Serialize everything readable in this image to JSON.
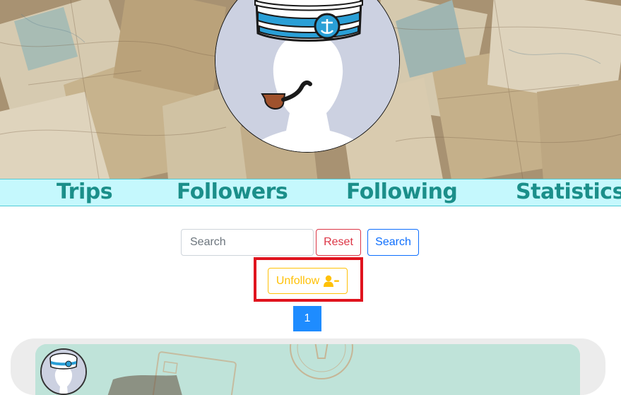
{
  "nav": {
    "trips": "Trips",
    "followers": "Followers",
    "following": "Following",
    "statistics": "Statistics"
  },
  "search": {
    "placeholder": "Search",
    "value": ""
  },
  "buttons": {
    "reset": "Reset",
    "search": "Search",
    "unfollow": "Unfollow"
  },
  "pagination": {
    "current_page": "1"
  },
  "colors": {
    "nav_text": "#1b8f8a",
    "nav_bg": "#c5f8fd",
    "reset": "#dc3545",
    "search": "#0d6efd",
    "unfollow": "#ffc107",
    "page_active": "#1e8cff",
    "highlight": "#e0141e"
  },
  "icons": {
    "unfollow": "user-minus-icon"
  }
}
